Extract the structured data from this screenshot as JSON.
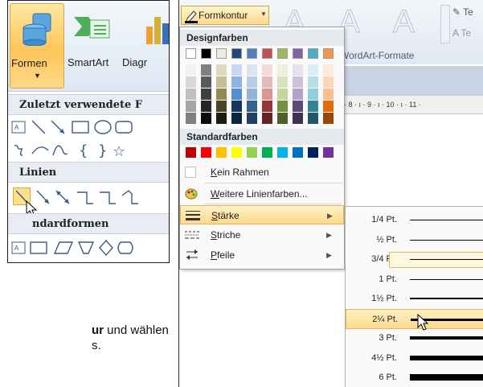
{
  "left": {
    "ribbon": {
      "formen_label": "Formen",
      "smartart_label": "SmartArt",
      "diagramm_label": "Diagr"
    },
    "gallery": {
      "recent_title": "Zuletzt verwendete F",
      "lines_title": "Linien",
      "basic_title": "ndardformen"
    }
  },
  "caption": {
    "line1_a": "ur",
    "line1_b": " und wählen",
    "line2": "s."
  },
  "right": {
    "formkontur_label": "Formkontur",
    "wordart_label": "WordArt-Formate",
    "ruler_text": "· 8 · ı · 9 · ı · 10 · ı · 11 ·",
    "design_title": "Designfarben",
    "standard_title": "Standardfarben",
    "menu": {
      "kein_rahmen": "Kein Rahmen",
      "weitere": "Weitere Linienfarben...",
      "staerke": "Stärke",
      "striche": "Striche",
      "pfeile": "Pfeile"
    },
    "weights": [
      {
        "label": "1/4 Pt.",
        "pt": 0.25
      },
      {
        "label": "½ Pt.",
        "pt": 0.5
      },
      {
        "label": "3/4 Pt.",
        "pt": 0.75
      },
      {
        "label": "1 Pt.",
        "pt": 1
      },
      {
        "label": "1½ Pt.",
        "pt": 1.5
      },
      {
        "label": "2¼ Pt.",
        "pt": 2.25
      },
      {
        "label": "3 Pt.",
        "pt": 3
      },
      {
        "label": "4½ Pt.",
        "pt": 4.5
      },
      {
        "label": "6 Pt.",
        "pt": 6
      }
    ],
    "highlighted_weight": "2¼ Pt.",
    "outlined_weight": "3/4 Pt."
  },
  "colors": {
    "theme_top": [
      "#ffffff",
      "#000000",
      "#eeece1",
      "#1f497d",
      "#4f81bd",
      "#c0504d",
      "#9bbb59",
      "#8064a2",
      "#4bacc6",
      "#f79646"
    ],
    "theme_shades": [
      [
        "#f2f2f2",
        "#7f7f7f",
        "#ddd9c3",
        "#c6d9f0",
        "#dbe5f1",
        "#f2dcdb",
        "#ebf1dd",
        "#e5e0ec",
        "#dbeef3",
        "#fdeada"
      ],
      [
        "#d8d8d8",
        "#595959",
        "#c4bd97",
        "#8db3e2",
        "#b8cce4",
        "#e5b9b7",
        "#d7e3bc",
        "#ccc1d9",
        "#b7dde8",
        "#fbd5b5"
      ],
      [
        "#bfbfbf",
        "#3f3f3f",
        "#938953",
        "#548dd4",
        "#95b3d7",
        "#d99694",
        "#c3d69b",
        "#b2a2c7",
        "#92cddc",
        "#fac08f"
      ],
      [
        "#a5a5a5",
        "#262626",
        "#494429",
        "#17365d",
        "#366092",
        "#953734",
        "#76923c",
        "#5f497a",
        "#31859b",
        "#e36c09"
      ],
      [
        "#7f7f7f",
        "#0c0c0c",
        "#1d1b10",
        "#0f243e",
        "#244061",
        "#632423",
        "#4f6128",
        "#3f3151",
        "#205867",
        "#974806"
      ]
    ],
    "standard": [
      "#c00000",
      "#ff0000",
      "#ffc000",
      "#ffff00",
      "#92d050",
      "#00b050",
      "#00b0f0",
      "#0070c0",
      "#002060",
      "#7030a0"
    ]
  }
}
